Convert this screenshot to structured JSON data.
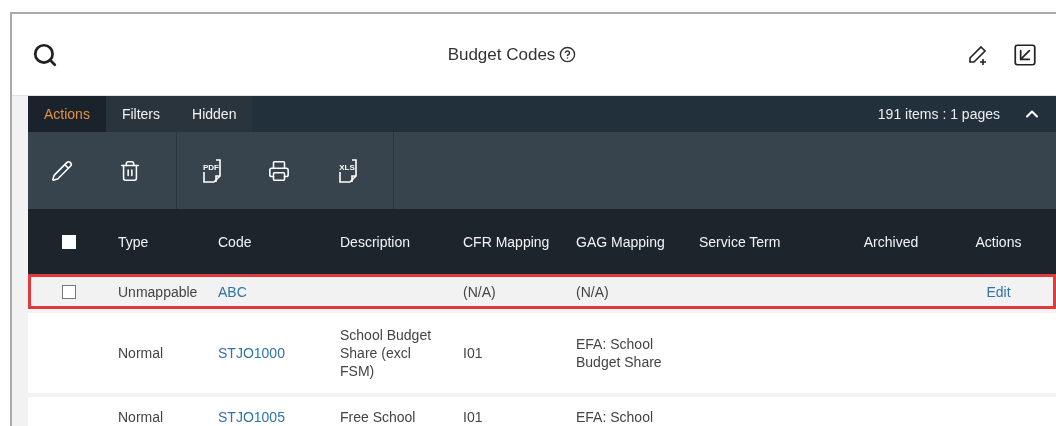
{
  "header": {
    "title": "Budget Codes"
  },
  "tabs": [
    {
      "label": "Actions",
      "selected": true
    },
    {
      "label": "Filters",
      "selected": false
    },
    {
      "label": "Hidden",
      "selected": false
    }
  ],
  "pager": {
    "text": "191 items : 1 pages",
    "expanded": true
  },
  "toolbar": {
    "groups": [
      [
        {
          "kind": "edit"
        },
        {
          "kind": "delete"
        }
      ],
      [
        {
          "kind": "file",
          "label": "PDF"
        },
        {
          "kind": "print"
        },
        {
          "kind": "file",
          "label": "XLS"
        }
      ]
    ]
  },
  "table": {
    "columns": [
      "Type",
      "Code",
      "Description",
      "CFR Mapping",
      "GAG Mapping",
      "Service Term",
      "Archived",
      "Actions"
    ],
    "select_all": {
      "checked": false
    },
    "rows": [
      {
        "selected": true,
        "checked": false,
        "cells": [
          "Unmappable",
          "ABC",
          "",
          "(N/A)",
          "(N/A)",
          "",
          "",
          "Edit"
        ]
      },
      {
        "selected": false,
        "cells": [
          "Normal",
          "STJO1000",
          "School Budget Share (excl FSM)",
          "I01",
          "EFA: School Budget Share",
          "",
          "",
          ""
        ]
      },
      {
        "selected": false,
        "cells": [
          "Normal",
          "STJO1005",
          "Free School",
          "I01",
          "EFA: School",
          "",
          "",
          ""
        ]
      }
    ]
  }
}
